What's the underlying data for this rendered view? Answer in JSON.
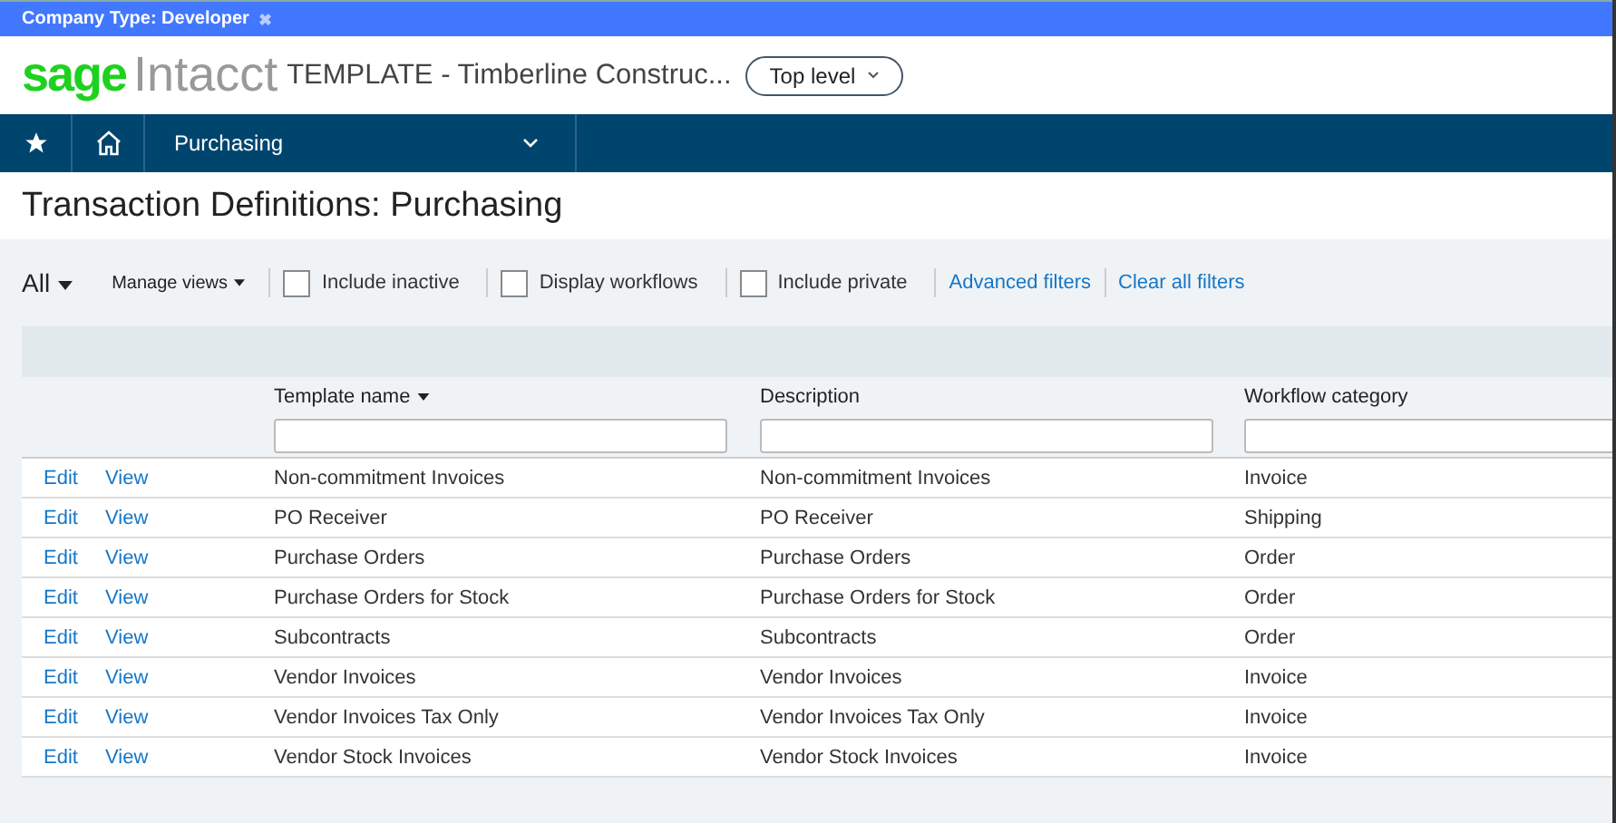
{
  "banner": {
    "text": "Company Type: Developer",
    "close": "✖"
  },
  "header": {
    "logo_sage": "sage",
    "logo_intacct": "Intacct",
    "company": "TEMPLATE - Timberline Construc...",
    "level_button": "Top level"
  },
  "nav": {
    "module": "Purchasing"
  },
  "page_title": "Transaction Definitions: Purchasing",
  "toolbar": {
    "view": "All",
    "manage_views": "Manage views",
    "checkboxes": [
      {
        "label": "Include inactive",
        "checked": false
      },
      {
        "label": "Display workflows",
        "checked": false
      },
      {
        "label": "Include private",
        "checked": false
      }
    ],
    "links": [
      "Advanced filters",
      "Clear all filters"
    ]
  },
  "table": {
    "columns": [
      "Template name",
      "Description",
      "Workflow category"
    ],
    "rows": [
      {
        "edit": "Edit",
        "view": "View",
        "cells": [
          "Non-commitment Invoices",
          "Non-commitment Invoices",
          "Invoice"
        ]
      },
      {
        "edit": "Edit",
        "view": "View",
        "cells": [
          "PO Receiver",
          "PO Receiver",
          "Shipping"
        ]
      },
      {
        "edit": "Edit",
        "view": "View",
        "cells": [
          "Purchase Orders",
          "Purchase Orders",
          "Order"
        ]
      },
      {
        "edit": "Edit",
        "view": "View",
        "cells": [
          "Purchase Orders for Stock",
          "Purchase Orders for Stock",
          "Order"
        ]
      },
      {
        "edit": "Edit",
        "view": "View",
        "cells": [
          "Subcontracts",
          "Subcontracts",
          "Order"
        ]
      },
      {
        "edit": "Edit",
        "view": "View",
        "cells": [
          "Vendor Invoices",
          "Vendor Invoices",
          "Invoice"
        ]
      },
      {
        "edit": "Edit",
        "view": "View",
        "cells": [
          "Vendor Invoices Tax Only",
          "Vendor Invoices Tax Only",
          "Invoice"
        ]
      },
      {
        "edit": "Edit",
        "view": "View",
        "cells": [
          "Vendor Stock Invoices",
          "Vendor Stock Invoices",
          "Invoice"
        ]
      }
    ]
  }
}
